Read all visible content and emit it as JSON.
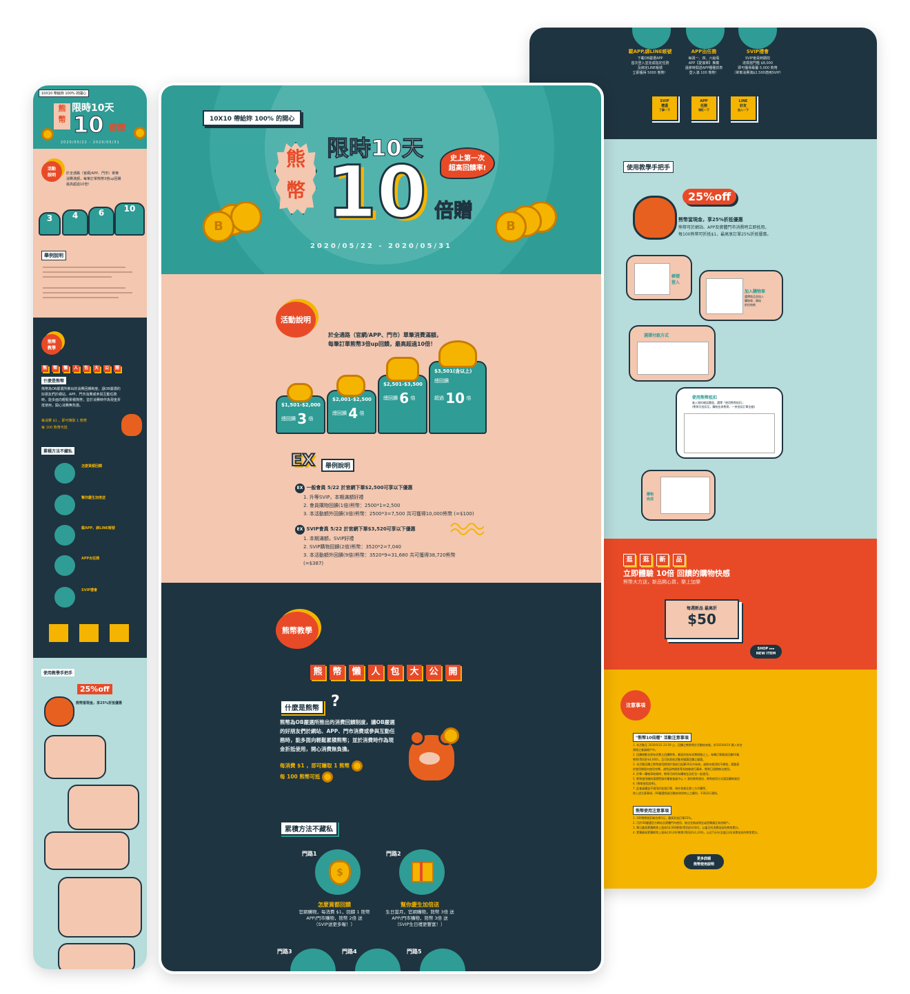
{
  "colors": {
    "teal": "#2f9c95",
    "peach": "#f3c7b0",
    "navy": "#1e3440",
    "orange": "#e84a27",
    "yellow": "#f5b400",
    "lightblue": "#b6dcdb"
  },
  "hero": {
    "badge": "10X10 帶給妳 100% 的開心",
    "kuma": "熊幣",
    "limited": "限時10天",
    "ten": "10",
    "double": "倍贈",
    "first": "史上第一次\n超高回饋率!",
    "dates": "2020/05/22 - 2020/05/31",
    "coin_letter": "B"
  },
  "activity": {
    "title": "活動說明",
    "desc": "於全通路（官網/APP、門市）單筆消費滿額，\n每筆訂單熊幣3倍up回饋，最高超過10倍！",
    "tiers": [
      {
        "range": "$1,501-$2,000",
        "label": "總回饋",
        "mult": "3",
        "suffix": "倍"
      },
      {
        "range": "$2,001-$2,500",
        "label": "總回饋",
        "mult": "4",
        "suffix": "倍"
      },
      {
        "range": "$2,501-$3,500",
        "label": "總回饋",
        "mult": "6",
        "suffix": "倍"
      },
      {
        "range": "$3,501(含以上)",
        "label": "總回饋",
        "prefix": "超過",
        "mult": "10",
        "suffix": "倍"
      }
    ],
    "ex_logo": "EX",
    "ex_title": "舉例說明",
    "ex1_head": "一般會員 5/22 於官網下單$2,500可享以下優惠",
    "ex1_lines": [
      "1. 升等SVIP，本期滿額好禮",
      "2. 會員購物回饋(1倍)熊幣：2500*1=2,500",
      "3. 本活動額外回饋(3倍)熊幣：2500*3=7,500 共可獲得10,000熊幣 (=$100)"
    ],
    "ex2_head": "SVIP會員 5/22 於官網下單$3,520可享以下優惠",
    "ex2_lines": [
      "1. 本期滿額，SVIP好禮",
      "2. SVIP購物回饋(2倍)熊幣：3520*2=7,040",
      "3. 本活動額外回饋(9倍)熊幣：3520*9=31,680 共可獲得38,720熊幣 (=$387)"
    ]
  },
  "tutorial": {
    "title": "熊幣教學",
    "chars": [
      "熊",
      "幣",
      "懶",
      "人",
      "包",
      "大",
      "公",
      "開"
    ],
    "what_title": "什麼是熊幣",
    "what_desc": "熊幣為OB嚴選所推出的消費回饋制度，讓OB嚴選的好朋友們於網站、APP、門市消費或參與互動任務時，能多面向輕鬆累積熊幣；並於消費時作為現金折抵使用，開心消費無負擔。",
    "rate1": "每消費 $1 ，即可賺取 1 熊幣",
    "rate2": "每 100 熊幣可抵",
    "accum_title": "累積方法不藏私",
    "m1_label": "門路1",
    "m1_title": "怎麼買都回饋",
    "m1_desc": "官網購物，每消費 $1，回饋 1 熊幣\nAPP/門市購物，熊幣 2倍 送\n（SVIP送更多喔！）",
    "m2_label": "門路2",
    "m2_title": "幫你慶生加倍送",
    "m2_desc": "生日當月，官網購物，熊幣 3倍 送\nAPP/門市購物，熊幣 3倍 送\n（SVIP生日禮更豐富！）",
    "m3_label": "門路3",
    "m4_label": "門路4",
    "m5_label": "門路5"
  },
  "right": {
    "top_labels": [
      "載APP,綁LINE帳號",
      "APP出任務",
      "SVIP禮會"
    ],
    "top_descs": [
      "下載OB嚴選APP\n首次登入並完成指定任務\n及綁定LINE帳號\n立即獲得 5000 熊幣！",
      "每週一、四、六給看\nAPP【愛接單】推薦\n還將時間送APP種種抓表\n登入滿 100 熊幣！",
      "SVIP會員到期前\n達標當門檻 $8,000\n即可獲得專屬 5,000 熊幣\n（單筆消費滿$2,500適用SVIP）"
    ],
    "badges": [
      "SVIP\n禮遇",
      "APP\n任務",
      "LINE\n好友"
    ],
    "badge_sub": [
      "了解一下",
      "領紅一下",
      "加入一下"
    ],
    "teach_title": "使用教學手把手",
    "off": "25%off",
    "teach_head": "熊幣當現金，享25%折抵優惠",
    "teach_desc": "熊幣可於網站、APP及實體門市消費時立即抵用，\n每100熊幣可折抵$1，最高享訂單25%折抵優惠。",
    "steps": [
      "帳號\n登入",
      "加入購物車",
      "選擇付款方式",
      "使用熊幣抵扣",
      "購物\n完成"
    ],
    "step4_desc": "進入資料確認畫面，選擇「使用熊幣抵扣」\n(熊幣可抵扣至，購物金與熊幣，一併抵扣訂單金額)",
    "step2_desc": "選擇商品並加入\n購物車，開始\n前往結帳",
    "shop_chars": [
      "逛",
      "逛",
      "新",
      "品"
    ],
    "shop_title": "立即體驗 10倍 回饋的購物快感",
    "shop_sub": "熊幣大方送，新品開心買，樂上加樂",
    "ticket_sub": "每週新品 最高折",
    "ticket_amount": "$50",
    "shop_btn": "SHOP ▸▸▸\nNEW ITEM",
    "notice_title": "注意事項",
    "notice_h1": "\"熊幣10倍贈\" 活動注意事項",
    "notice_lines1": [
      "1. 本活動至 2020/5/31 23:59 止，回饋之熊幣將於活動結束後，於2020/6/19 匯入符合",
      "   資格之會員帳戶中。",
      "2. 回饋總數含原有消費之回饋熊幣，最高折抵有消費期間之上，每筆訂單最高回饋40萬",
      "   熊幣(等同於$4,000)，且可與其他活動享優惠回饋之優惠。",
      "3. 本活動回饋之熊幣使用期限於發放日起算30天內有效，逾期未使用則不補發，請盡速",
      "   於使用期限內使用完畢，避免因時間差等系統維修打算券，熊幣已過期無法使用。",
      "4. 於單一購物車結帳時，熊幣可與所有購物金及紅包一起使用。",
      "5. 熊幣使用細則請瀏覽操作購會會員中心 > 我的熊幣資訊，熊幣使用方式請見購物資訊",
      "6. (熊幣使用說明)。",
      "7. 此會員權益不適用於批發訂單、海外發貨及第三方代購等。",
      "   除上述注意事項，OB嚴選保留活動修改與終止之權利，不再另行通知。"
    ],
    "notice_h2": "熊幣使用注意事項",
    "notice_lines2": [
      "1. 100熊幣抵扣新台幣1元，最高折抵訂單25%。",
      "2. 可於OB嚴選官方網站及實體門市使用，無法兌換成現金或是轉讓至其他帳戶。",
      "3. 單日最高累積熊幣上限為50,000熊幣(等同於$500)，以當日所消費抵扣的熊幣累計。",
      "4. 累積最高累積熊幣上限為120,000熊幣(等同於$1,200)，以近7天內(含當日)所消費抵扣的熊幣累計。"
    ],
    "more_btn": "更多詳細\n熊幣使用說明"
  },
  "left": {
    "badge": "10X10 帶給妳 100% 的開心",
    "limited": "限時10天",
    "ten": "10",
    "double": "倍贈",
    "dates": "2020/05/22 - 2020/05/31",
    "activity_title": "活動\n說明",
    "activity_desc": "於全通路（官網/APP、門市）單筆\n消費滿額，每筆訂單熊幣3倍up回饋\n最高超過10倍！",
    "tier_mults": [
      "3",
      "4",
      "6",
      "10"
    ],
    "ex_title": "舉例說明",
    "tut_title": "熊幣\n教學",
    "what_title": "什麼是熊幣",
    "what_desc": "熊幣為OB嚴選所推出的消費回饋制度，讓OB嚴選的好朋友們於網站、APP、門市消費或參與互動任務時，能多面向輕鬆累積熊幣；並於消費時作為現金折抵使用，開心消費無負擔。",
    "rate1": "每消費 $1 ，即可賺取 1 熊幣",
    "rate2": "每 100 熊幣可抵",
    "accum_title": "累積方法不藏私",
    "methods": [
      "怎麼買都回饋",
      "幫你慶生加倍送",
      "載APP、綁LINE帳號",
      "APP出任務",
      "SVIP禮會"
    ],
    "teach_title": "使用教學手把手",
    "off": "25%off",
    "teach_head": "熊幣當現金，享25%折抵優惠"
  }
}
